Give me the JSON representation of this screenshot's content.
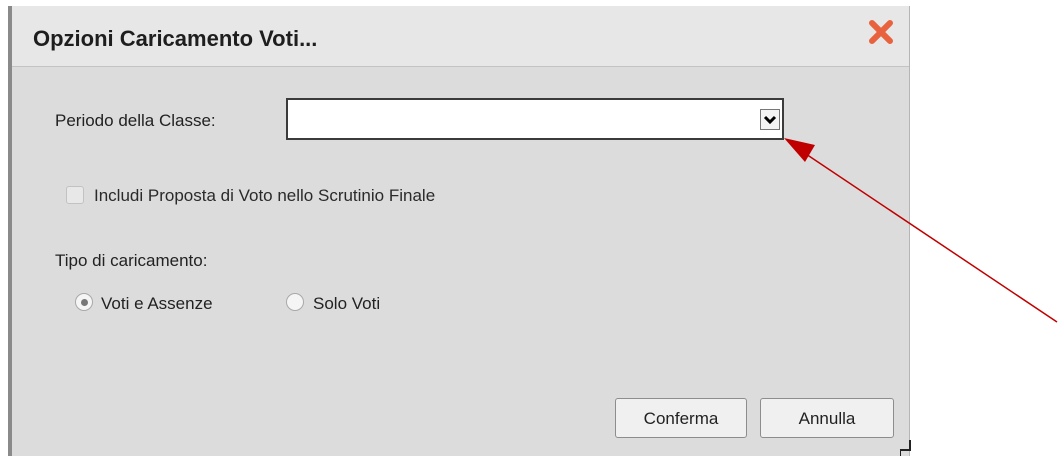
{
  "dialog": {
    "title": "Opzioni Caricamento Voti...",
    "periodo_label": "Periodo della Classe:",
    "periodo_value": "",
    "includi_label": "Includi Proposta di Voto nello Scrutinio Finale",
    "tipo_label": "Tipo di caricamento:",
    "radio_voti_assenze": "Voti e Assenze",
    "radio_solo_voti": "Solo Voti",
    "confirm_label": "Conferma",
    "cancel_label": "Annulla"
  },
  "icons": {
    "close": "close-icon",
    "dropdown": "chevron-down-icon",
    "resize": "resize-grip-icon"
  },
  "colors": {
    "close_red": "#e8623d",
    "annotation_arrow": "#c00000",
    "dialog_bg": "#dcdcdc"
  }
}
